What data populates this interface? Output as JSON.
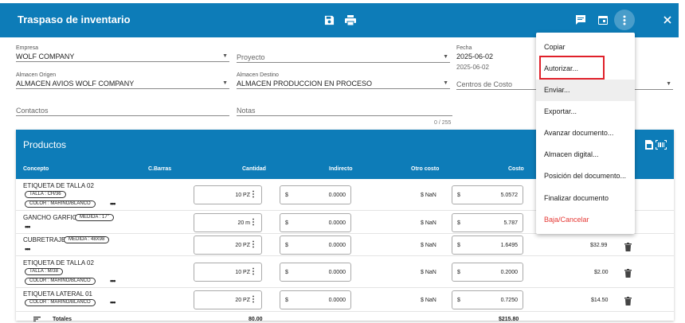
{
  "header": {
    "title": "Traspaso de inventario"
  },
  "form": {
    "empresa": {
      "label": "Empresa",
      "value": "WOLF COMPANY"
    },
    "proyecto": {
      "placeholder": "Proyecto"
    },
    "fecha": {
      "label": "Fecha",
      "value": "2025-06-02",
      "sub": "2025-06-02"
    },
    "almacen_origen": {
      "label": "Almacen Origen",
      "value": "ALMACEN AVIOS WOLF COMPANY"
    },
    "almacen_destino": {
      "label": "Almacen Destino",
      "value": "ALMACEN PRODUCCION EN PROCESO"
    },
    "centros_costo": {
      "placeholder": "Centros de Costo"
    },
    "contactos": {
      "placeholder": "Contactos"
    },
    "notas": {
      "placeholder": "Notas",
      "counter": "0 / 255"
    }
  },
  "products": {
    "title": "Productos",
    "columns": {
      "concepto": "Concepto",
      "barras": "C.Barras",
      "cantidad": "Cantidad",
      "indirecto": "Indirecto",
      "otro": "Otro costo",
      "costo": "Costo"
    },
    "rows": [
      {
        "name": "ETIQUETA DE TALLA 02",
        "tags": [
          "TALLA : CH/36",
          "COLOR : MARINO/BLANCO"
        ],
        "qty": "10 PZ",
        "indirecto": "0.0000",
        "otro": "$ NaN",
        "costo": "5.0572",
        "price": ""
      },
      {
        "name": "GANCHO GARFIO",
        "tags": [
          "MEDIDA : 17\""
        ],
        "qty": "20 m",
        "indirecto": "0.0000",
        "otro": "$ NaN",
        "costo": "5.787",
        "price": ""
      },
      {
        "name": "CUBRETRAJE",
        "tags": [
          "MEDIDA : 48X98"
        ],
        "qty": "20 PZ",
        "indirecto": "0.0000",
        "otro": "$ NaN",
        "costo": "1.6495",
        "price": "$32.99"
      },
      {
        "name": "ETIQUETA DE TALLA 02",
        "tags": [
          "TALLA : M/38",
          "COLOR : MARINO/BLANCO"
        ],
        "qty": "10 PZ",
        "indirecto": "0.0000",
        "otro": "$ NaN",
        "costo": "0.2000",
        "price": "$2.00"
      },
      {
        "name": "ETIQUETA LATERAL 01",
        "tags": [
          "COLOR : MARINO/BLANCO"
        ],
        "qty": "20 PZ",
        "indirecto": "0.0000",
        "otro": "$ NaN",
        "costo": "0.7250",
        "price": "$14.50"
      }
    ],
    "currency": "$",
    "totals": {
      "label": "Totales",
      "qty": "80.00",
      "amount": "$215.80"
    }
  },
  "menu": {
    "items": [
      "Copiar",
      "Autorizar...",
      "Enviar...",
      "Exportar...",
      "Avanzar documento...",
      "Almacen digital...",
      "Posición del documento...",
      "Finalizar documento",
      "Baja/Cancelar"
    ]
  },
  "colors": {
    "primary": "#0d7cb8",
    "danger": "#e53935",
    "highlight": "#e0202a"
  }
}
